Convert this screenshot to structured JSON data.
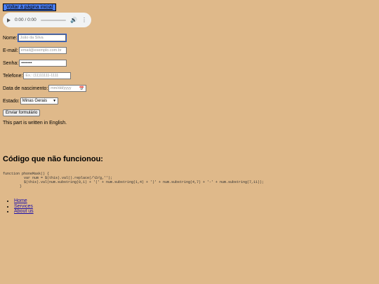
{
  "back_button": {
    "label": "Voltar à página inicial"
  },
  "audio": {
    "time": "0:00 / 0:00",
    "play_icon": "play-icon",
    "volume_icon": "volume-icon",
    "more_icon": "more-vert-icon"
  },
  "form": {
    "name_label": "Nome:",
    "name_placeholder": "João da Silva",
    "email_label": "E-mail:",
    "email_placeholder": "email@exemplo.com.br",
    "password_label": "Senha:",
    "password_value": "••••••••",
    "phone_label": "Telefone:",
    "phone_placeholder": "Ex.: (11)11111-1111",
    "birth_label": "Data de nascimento:",
    "birth_placeholder": "mm/dd/yyyy",
    "state_label": "Estado:",
    "state_value": "Minas Gerais",
    "submit_label": "Enviar formulário"
  },
  "english_text": "This part is written in English.",
  "heading": "Código que não funcionou:",
  "code": "function phoneMask() {\n          var num = $(this).val().replace(/\\D/g,'');\n          $(this).val(num.substring(0,1) + '(' + num.substring(1,4) + ')' + num.substring(4,7) + '-' + num.substring(7,11));\n        }",
  "nav": {
    "items": [
      "Home",
      "Services",
      "About us"
    ]
  },
  "colors": {
    "background": "#dfb98a",
    "button": "#4a7df0",
    "link": "#1a0dab"
  }
}
